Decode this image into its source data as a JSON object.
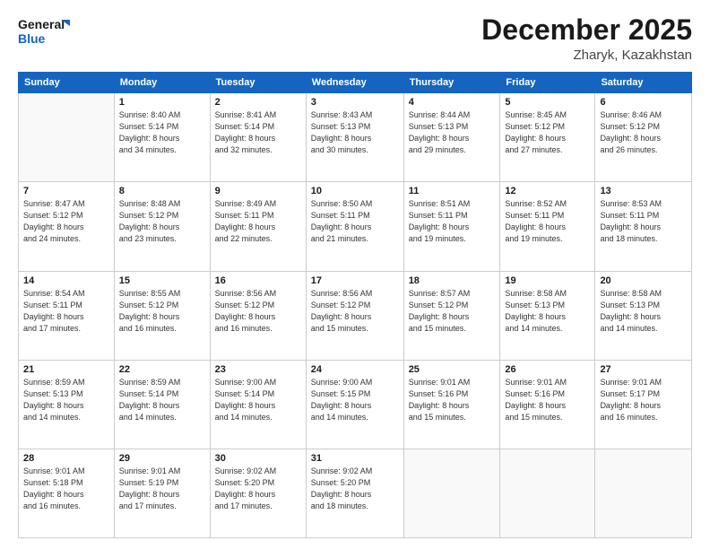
{
  "logo": {
    "line1": "General",
    "line2": "Blue"
  },
  "title": "December 2025",
  "subtitle": "Zharyk, Kazakhstan",
  "days_of_week": [
    "Sunday",
    "Monday",
    "Tuesday",
    "Wednesday",
    "Thursday",
    "Friday",
    "Saturday"
  ],
  "weeks": [
    [
      {
        "day": "",
        "info": ""
      },
      {
        "day": "1",
        "info": "Sunrise: 8:40 AM\nSunset: 5:14 PM\nDaylight: 8 hours\nand 34 minutes."
      },
      {
        "day": "2",
        "info": "Sunrise: 8:41 AM\nSunset: 5:14 PM\nDaylight: 8 hours\nand 32 minutes."
      },
      {
        "day": "3",
        "info": "Sunrise: 8:43 AM\nSunset: 5:13 PM\nDaylight: 8 hours\nand 30 minutes."
      },
      {
        "day": "4",
        "info": "Sunrise: 8:44 AM\nSunset: 5:13 PM\nDaylight: 8 hours\nand 29 minutes."
      },
      {
        "day": "5",
        "info": "Sunrise: 8:45 AM\nSunset: 5:12 PM\nDaylight: 8 hours\nand 27 minutes."
      },
      {
        "day": "6",
        "info": "Sunrise: 8:46 AM\nSunset: 5:12 PM\nDaylight: 8 hours\nand 26 minutes."
      }
    ],
    [
      {
        "day": "7",
        "info": "Sunrise: 8:47 AM\nSunset: 5:12 PM\nDaylight: 8 hours\nand 24 minutes."
      },
      {
        "day": "8",
        "info": "Sunrise: 8:48 AM\nSunset: 5:12 PM\nDaylight: 8 hours\nand 23 minutes."
      },
      {
        "day": "9",
        "info": "Sunrise: 8:49 AM\nSunset: 5:11 PM\nDaylight: 8 hours\nand 22 minutes."
      },
      {
        "day": "10",
        "info": "Sunrise: 8:50 AM\nSunset: 5:11 PM\nDaylight: 8 hours\nand 21 minutes."
      },
      {
        "day": "11",
        "info": "Sunrise: 8:51 AM\nSunset: 5:11 PM\nDaylight: 8 hours\nand 19 minutes."
      },
      {
        "day": "12",
        "info": "Sunrise: 8:52 AM\nSunset: 5:11 PM\nDaylight: 8 hours\nand 19 minutes."
      },
      {
        "day": "13",
        "info": "Sunrise: 8:53 AM\nSunset: 5:11 PM\nDaylight: 8 hours\nand 18 minutes."
      }
    ],
    [
      {
        "day": "14",
        "info": "Sunrise: 8:54 AM\nSunset: 5:11 PM\nDaylight: 8 hours\nand 17 minutes."
      },
      {
        "day": "15",
        "info": "Sunrise: 8:55 AM\nSunset: 5:12 PM\nDaylight: 8 hours\nand 16 minutes."
      },
      {
        "day": "16",
        "info": "Sunrise: 8:56 AM\nSunset: 5:12 PM\nDaylight: 8 hours\nand 16 minutes."
      },
      {
        "day": "17",
        "info": "Sunrise: 8:56 AM\nSunset: 5:12 PM\nDaylight: 8 hours\nand 15 minutes."
      },
      {
        "day": "18",
        "info": "Sunrise: 8:57 AM\nSunset: 5:12 PM\nDaylight: 8 hours\nand 15 minutes."
      },
      {
        "day": "19",
        "info": "Sunrise: 8:58 AM\nSunset: 5:13 PM\nDaylight: 8 hours\nand 14 minutes."
      },
      {
        "day": "20",
        "info": "Sunrise: 8:58 AM\nSunset: 5:13 PM\nDaylight: 8 hours\nand 14 minutes."
      }
    ],
    [
      {
        "day": "21",
        "info": "Sunrise: 8:59 AM\nSunset: 5:13 PM\nDaylight: 8 hours\nand 14 minutes."
      },
      {
        "day": "22",
        "info": "Sunrise: 8:59 AM\nSunset: 5:14 PM\nDaylight: 8 hours\nand 14 minutes."
      },
      {
        "day": "23",
        "info": "Sunrise: 9:00 AM\nSunset: 5:14 PM\nDaylight: 8 hours\nand 14 minutes."
      },
      {
        "day": "24",
        "info": "Sunrise: 9:00 AM\nSunset: 5:15 PM\nDaylight: 8 hours\nand 14 minutes."
      },
      {
        "day": "25",
        "info": "Sunrise: 9:01 AM\nSunset: 5:16 PM\nDaylight: 8 hours\nand 15 minutes."
      },
      {
        "day": "26",
        "info": "Sunrise: 9:01 AM\nSunset: 5:16 PM\nDaylight: 8 hours\nand 15 minutes."
      },
      {
        "day": "27",
        "info": "Sunrise: 9:01 AM\nSunset: 5:17 PM\nDaylight: 8 hours\nand 16 minutes."
      }
    ],
    [
      {
        "day": "28",
        "info": "Sunrise: 9:01 AM\nSunset: 5:18 PM\nDaylight: 8 hours\nand 16 minutes."
      },
      {
        "day": "29",
        "info": "Sunrise: 9:01 AM\nSunset: 5:19 PM\nDaylight: 8 hours\nand 17 minutes."
      },
      {
        "day": "30",
        "info": "Sunrise: 9:02 AM\nSunset: 5:20 PM\nDaylight: 8 hours\nand 17 minutes."
      },
      {
        "day": "31",
        "info": "Sunrise: 9:02 AM\nSunset: 5:20 PM\nDaylight: 8 hours\nand 18 minutes."
      },
      {
        "day": "",
        "info": ""
      },
      {
        "day": "",
        "info": ""
      },
      {
        "day": "",
        "info": ""
      }
    ]
  ]
}
